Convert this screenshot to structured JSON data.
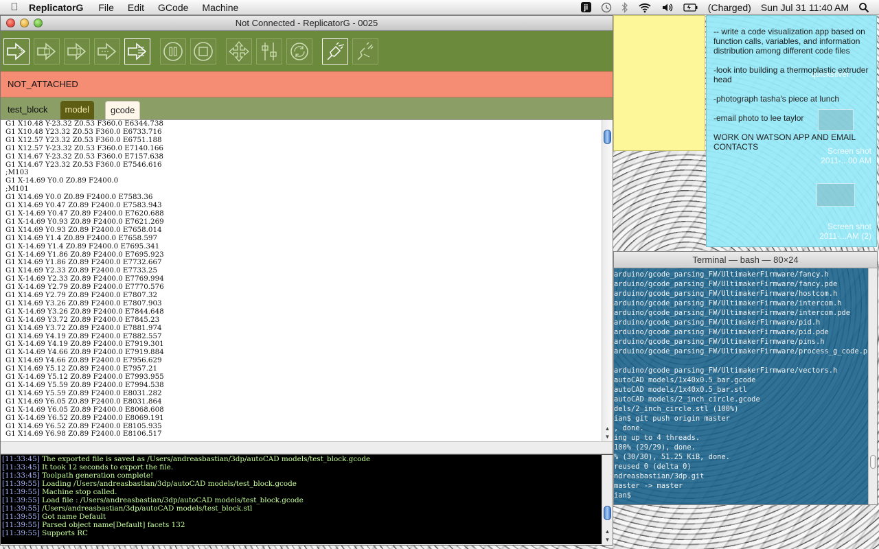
{
  "menubar": {
    "app_name": "ReplicatorG",
    "menus": [
      "File",
      "Edit",
      "GCode",
      "Machine"
    ],
    "ji_label": "ji",
    "battery_text": "(Charged)",
    "datetime": "Sun Jul 31  11:40 AM"
  },
  "stickies": {
    "blue_notes": [
      "-- write a code visualization app based on function calls, variables, and information distribution among different code files",
      "-look into building a thermoplastic extruder head",
      "-photograph tasha's piece at lunch",
      "-email photo to lee taylor",
      "WORK ON WATSON APP AND EMAIL CONTACTS"
    ]
  },
  "desktop_icons": {
    "icon1": "quicksilver",
    "icon2_line1": "Screen shot",
    "icon2_line2": "2011-...00 AM",
    "icon3_line1": "Screen shot",
    "icon3_line2": "2011-...AM (2)"
  },
  "terminal": {
    "title": "Terminal — bash — 80×24",
    "lines": [
      "arduino/gcode_parsing_FW/UltimakerFirmware/fancy.h",
      "arduino/gcode_parsing_FW/UltimakerFirmware/fancy.pde",
      "arduino/gcode_parsing_FW/UltimakerFirmware/hostcom.h",
      "arduino/gcode_parsing_FW/UltimakerFirmware/intercom.h",
      "arduino/gcode_parsing_FW/UltimakerFirmware/intercom.pde",
      "arduino/gcode_parsing_FW/UltimakerFirmware/pid.h",
      "arduino/gcode_parsing_FW/UltimakerFirmware/pid.pde",
      "arduino/gcode_parsing_FW/UltimakerFirmware/pins.h",
      "arduino/gcode_parsing_FW/UltimakerFirmware/process_g_code.pd",
      "",
      "arduino/gcode_parsing_FW/UltimakerFirmware/vectors.h",
      "autoCAD models/1x40x0.5_bar.gcode",
      "autoCAD models/1x40x0.5_bar.stl",
      "autoCAD models/2_inch_circle.gcode",
      "dels/2_inch_circle.stl (100%)",
      "ian$ git push origin master",
      ", done.",
      "ing up to 4 threads.",
      "100% (29/29), done.",
      "% (30/30), 51.25 KiB, done.",
      "reused 0 (delta 0)",
      "ndreasbastian/3dp.git",
      "master -> master",
      "ian$"
    ]
  },
  "window": {
    "title": "Not Connected - ReplicatorG - 0025",
    "status": "NOT_ATTACHED",
    "filename": "test_block",
    "tabs": {
      "model": "model",
      "gcode": "gcode"
    }
  },
  "gcode_lines": [
    "G1 X10.48 Y-23.32 Z0.53 F360.0 E6344.738",
    "G1 X10.48 Y23.32 Z0.53 F360.0 E6733.716",
    "G1 X12.57 Y23.32 Z0.53 F360.0 E6751.188",
    "G1 X12.57 Y-23.32 Z0.53 F360.0 E7140.166",
    "G1 X14.67 Y-23.32 Z0.53 F360.0 E7157.638",
    "G1 X14.67 Y23.32 Z0.53 F360.0 E7546.616",
    ";M103",
    "G1 X-14.69 Y0.0 Z0.89 F2400.0",
    ";M101",
    "G1 X14.69 Y0.0 Z0.89 F2400.0 E7583.36",
    "G1 X14.69 Y0.47 Z0.89 F2400.0 E7583.943",
    "G1 X-14.69 Y0.47 Z0.89 F2400.0 E7620.688",
    "G1 X-14.69 Y0.93 Z0.89 F2400.0 E7621.269",
    "G1 X14.69 Y0.93 Z0.89 F2400.0 E7658.014",
    "G1 X14.69 Y1.4 Z0.89 F2400.0 E7658.597",
    "G1 X-14.69 Y1.4 Z0.89 F2400.0 E7695.341",
    "G1 X-14.69 Y1.86 Z0.89 F2400.0 E7695.923",
    "G1 X14.69 Y1.86 Z0.89 F2400.0 E7732.667",
    "G1 X14.69 Y2.33 Z0.89 F2400.0 E7733.25",
    "G1 X-14.69 Y2.33 Z0.89 F2400.0 E7769.994",
    "G1 X-14.69 Y2.79 Z0.89 F2400.0 E7770.576",
    "G1 X14.69 Y2.79 Z0.89 F2400.0 E7807.32",
    "G1 X14.69 Y3.26 Z0.89 F2400.0 E7807.903",
    "G1 X-14.69 Y3.26 Z0.89 F2400.0 E7844.648",
    "G1 X-14.69 Y3.72 Z0.89 F2400.0 E7845.23",
    "G1 X14.69 Y3.72 Z0.89 F2400.0 E7881.974",
    "G1 X14.69 Y4.19 Z0.89 F2400.0 E7882.557",
    "G1 X-14.69 Y4.19 Z0.89 F2400.0 E7919.301",
    "G1 X-14.69 Y4.66 Z0.89 F2400.0 E7919.884",
    "G1 X14.69 Y4.66 Z0.89 F2400.0 E7956.629",
    "G1 X14.69 Y5.12 Z0.89 F2400.0 E7957.21",
    "G1 X-14.69 Y5.12 Z0.89 F2400.0 E7993.955",
    "G1 X-14.69 Y5.59 Z0.89 F2400.0 E7994.538",
    "G1 X14.69 Y5.59 Z0.89 F2400.0 E8031.282",
    "G1 X14.69 Y6.05 Z0.89 F2400.0 E8031.864",
    "G1 X-14.69 Y6.05 Z0.89 F2400.0 E8068.608",
    "G1 X-14.69 Y6.52 Z0.89 F2400.0 E8069.191",
    "G1 X14.69 Y6.52 Z0.89 F2400.0 E8105.935",
    "G1 X14.69 Y6.98 Z0.89 F2400.0 E8106.517"
  ],
  "console": [
    {
      "ts": "[11:33:45]",
      "msg": "The exported file is saved as /Users/andreasbastian/3dp/autoCAD models/test_block.gcode"
    },
    {
      "ts": "[11:33:45]",
      "msg": "It took 12 seconds to export the file."
    },
    {
      "ts": "[11:33:45]",
      "msg": "Toolpath generation complete!"
    },
    {
      "ts": "[11:39:55]",
      "msg": "Loading /Users/andreasbastian/3dp/autoCAD models/test_block.gcode"
    },
    {
      "ts": "[11:39:55]",
      "msg": "Machine stop called."
    },
    {
      "ts": "[11:39:55]",
      "msg": "Load file : /Users/andreasbastian/3dp/autoCAD models/test_block.gcode"
    },
    {
      "ts": "[11:39:55]",
      "msg": "/Users/andreasbastian/3dp/autoCAD models/test_block.stl"
    },
    {
      "ts": "[11:39:55]",
      "msg": "Got name Default"
    },
    {
      "ts": "[11:39:55]",
      "msg": "Parsed object name[Default] facets 132"
    },
    {
      "ts": "[11:39:55]",
      "msg": "Supports RC"
    }
  ],
  "colors": {
    "toolbar": "#6c8a3c",
    "status_bar": "#f48d73",
    "tab_bar": "#8a9e66",
    "console_bg": "#000000",
    "console_text": "#c6ff9a",
    "console_timestamp": "#aab5ff",
    "sticky_yellow": "#fef79a",
    "sticky_blue": "#96e8f7",
    "terminal_bg": "#145f87"
  },
  "icons": {
    "toolbar": [
      "build-icon",
      "upload-icon",
      "build-to-file-icon",
      "build-remote-icon",
      "generate-gcode-icon",
      "pause-icon",
      "stop-icon",
      "control-panel-icon",
      "preferences-icon",
      "reset-icon",
      "connect-icon",
      "disconnect-icon"
    ],
    "status": [
      "apple-icon",
      "ji-icon",
      "time-machine-icon",
      "bluetooth-icon",
      "wifi-icon",
      "volume-icon",
      "battery-icon",
      "spotlight-icon"
    ]
  }
}
